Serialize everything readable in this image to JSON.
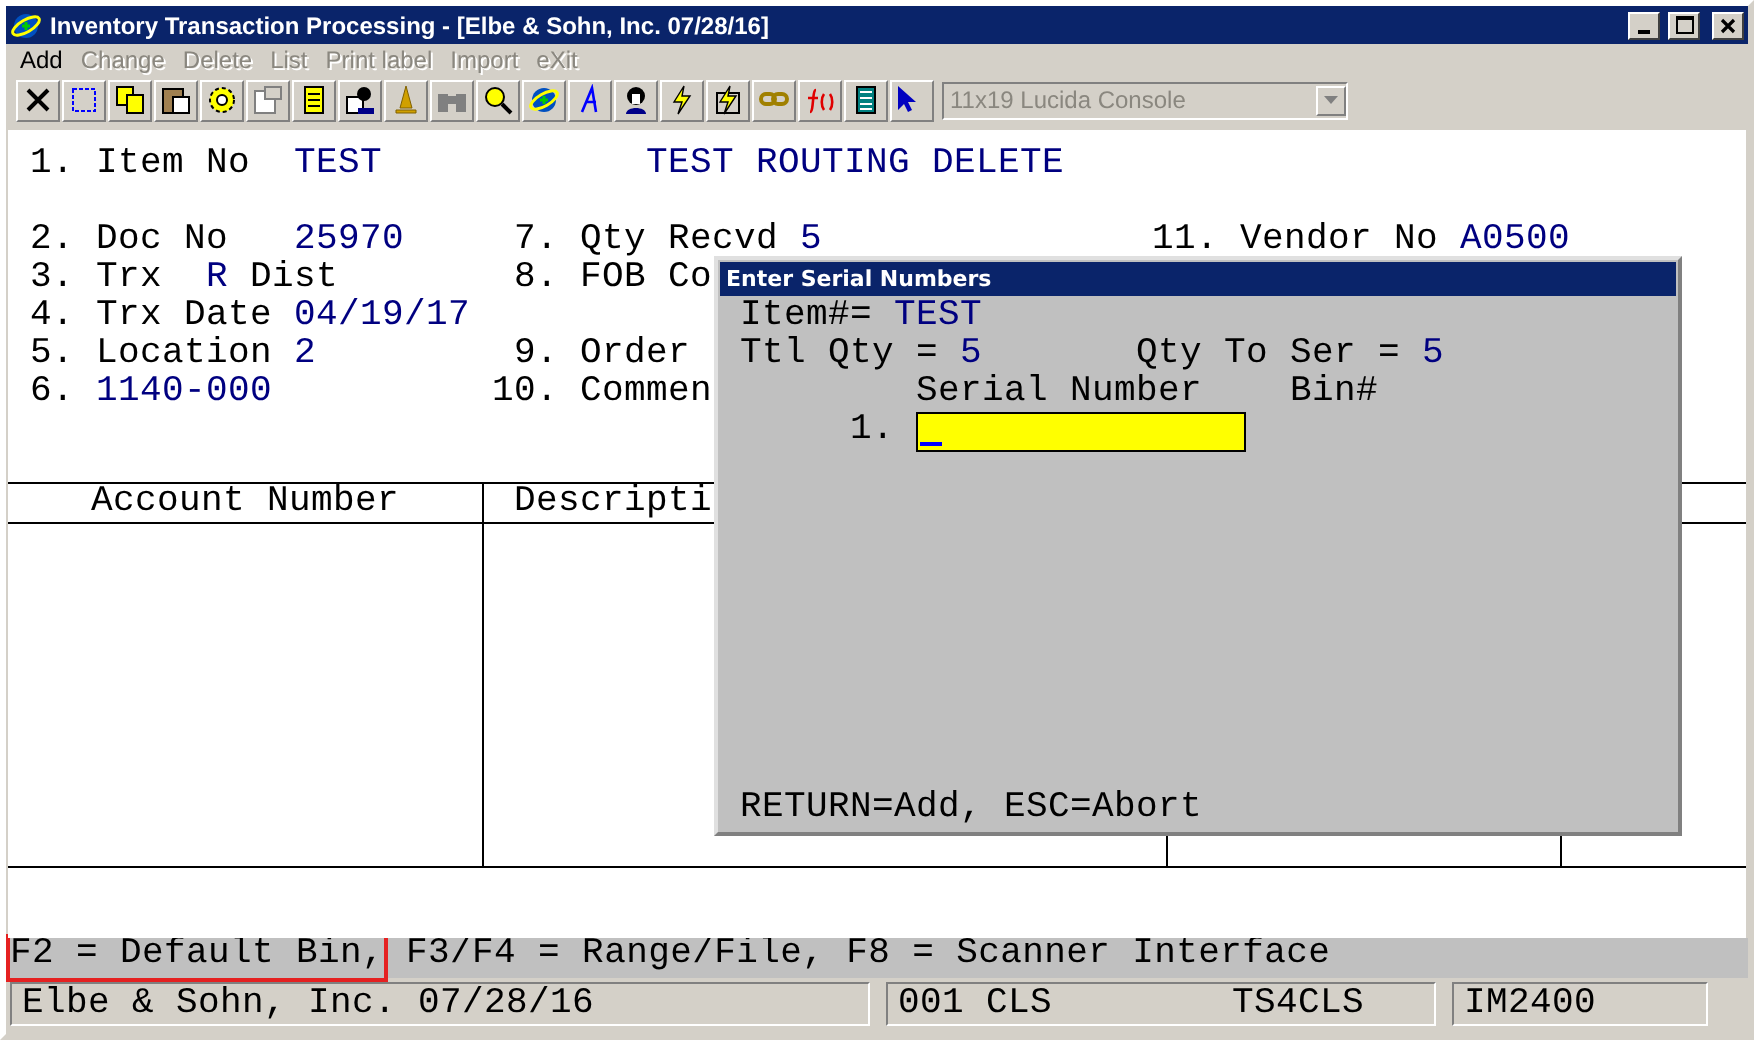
{
  "window": {
    "title": "Inventory Transaction Processing - [Elbe & Sohn, Inc. 07/28/16]"
  },
  "menu": [
    {
      "label": "Add",
      "disabled": false
    },
    {
      "label": "Change",
      "disabled": true
    },
    {
      "label": "Delete",
      "disabled": true
    },
    {
      "label": "List",
      "disabled": true
    },
    {
      "label": "Print label",
      "disabled": true
    },
    {
      "label": "Import",
      "disabled": true
    },
    {
      "label": "eXit",
      "disabled": true
    }
  ],
  "font_selector": {
    "value": "11x19 Lucida Console",
    "disabled": true
  },
  "header": {
    "number": "1.",
    "label": "Item No",
    "value": "TEST",
    "description": "TEST ROUTING DELETE"
  },
  "rows": [
    {
      "left": {
        "kind": "standard",
        "number": "2.",
        "label": "Doc No",
        "value": "25970"
      },
      "middle": {
        "number": "7.",
        "label": "Qty Recvd",
        "value": "5"
      },
      "right": {
        "number": "11.",
        "label": "Vendor No",
        "value": "A0500"
      }
    },
    {
      "left": {
        "kind": "code",
        "number": "3.",
        "label": "Trx",
        "value": "R",
        "suffix": "Dist"
      },
      "middle": {
        "number": "8.",
        "label": "FOB Co"
      }
    },
    {
      "left": {
        "kind": "standard",
        "number": "4.",
        "label": "Trx Date",
        "value": "04/19/17"
      }
    },
    {
      "left": {
        "kind": "standard",
        "number": "5.",
        "label": "Location",
        "value": "2"
      },
      "middle": {
        "number": "9.",
        "label": "Order"
      }
    },
    {
      "left": {
        "kind": "value_only",
        "number": "6.",
        "value": "1140-000"
      },
      "middle": {
        "number": "10.",
        "label": "Commen"
      }
    }
  ],
  "table": {
    "columns": [
      "Account Number",
      "Descripti"
    ]
  },
  "dialog": {
    "title": "Enter Serial Numbers",
    "item_label": "Item#=",
    "item_value": "TEST",
    "total_label": "Ttl Qty =",
    "total_value": "5",
    "to_serialize_label": "Qty To Ser =",
    "to_serialize_value": "5",
    "columns": [
      "Serial Number",
      "Bin#"
    ],
    "entries": [
      {
        "number": "1.",
        "active": true
      }
    ],
    "footer": "RETURN=Add, ESC=Abort"
  },
  "function_keys": [
    {
      "text": "F2 = Default Bin,",
      "highlighted": true
    },
    {
      "text": "F3/F4 = Range/File, F8 = Scanner Interface",
      "highlighted": false
    }
  ],
  "status_bar": [
    {
      "items": [
        "Elbe & Sohn, Inc. 07/28/16"
      ]
    },
    {
      "items": [
        "001 CLS",
        "TS4CLS"
      ]
    },
    {
      "items": [
        "IM2400"
      ]
    }
  ]
}
